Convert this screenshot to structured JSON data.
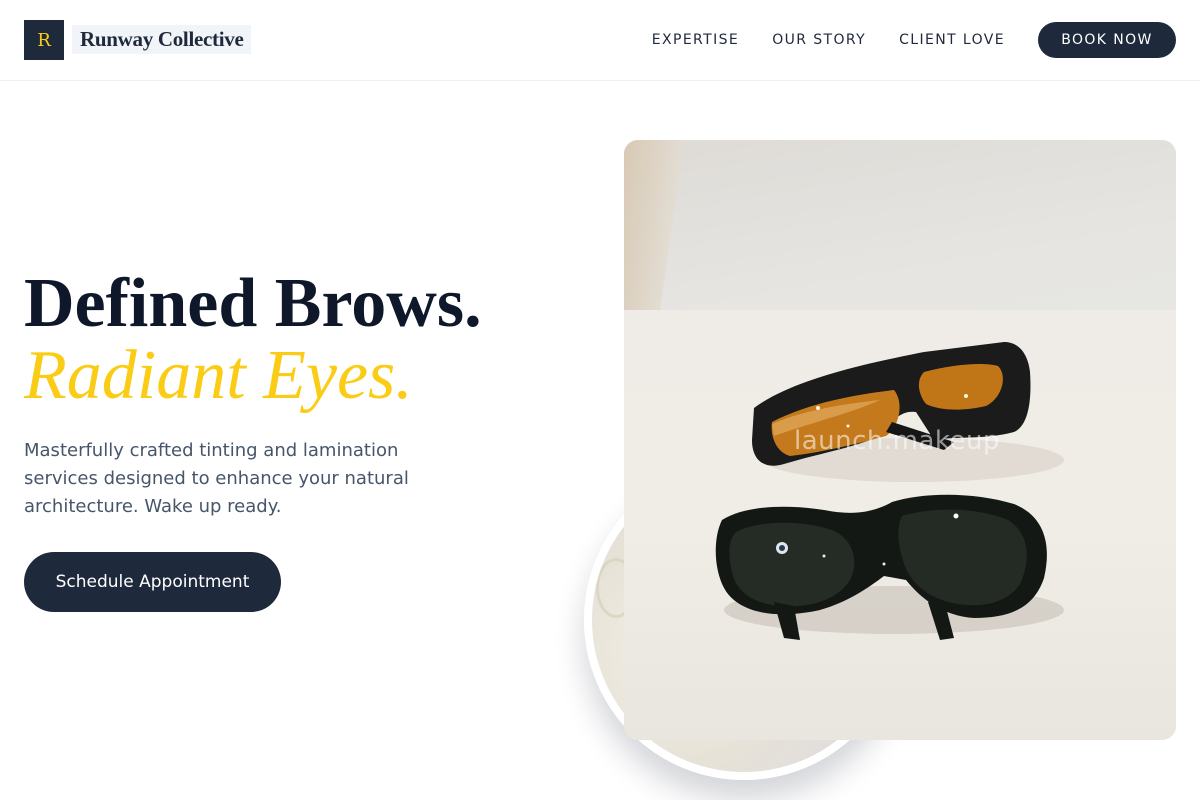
{
  "brand": {
    "mark": "R",
    "name": "Runway Collective"
  },
  "nav": {
    "items": [
      "EXPERTISE",
      "OUR STORY",
      "CLIENT LOVE"
    ],
    "cta": "BOOK NOW"
  },
  "hero": {
    "headline_line1": "Defined Brows.",
    "headline_line2": "Radiant Eyes.",
    "subtext": "Masterfully crafted tinting and lamination services designed to enhance your natural architecture. Wake up ready.",
    "cta": "Schedule Appointment"
  },
  "photo": {
    "watermark": "launch.makeup"
  },
  "colors": {
    "navy": "#1e293b",
    "accent_yellow": "#facc15",
    "text_dark": "#0f172a",
    "text_muted": "#475569"
  }
}
